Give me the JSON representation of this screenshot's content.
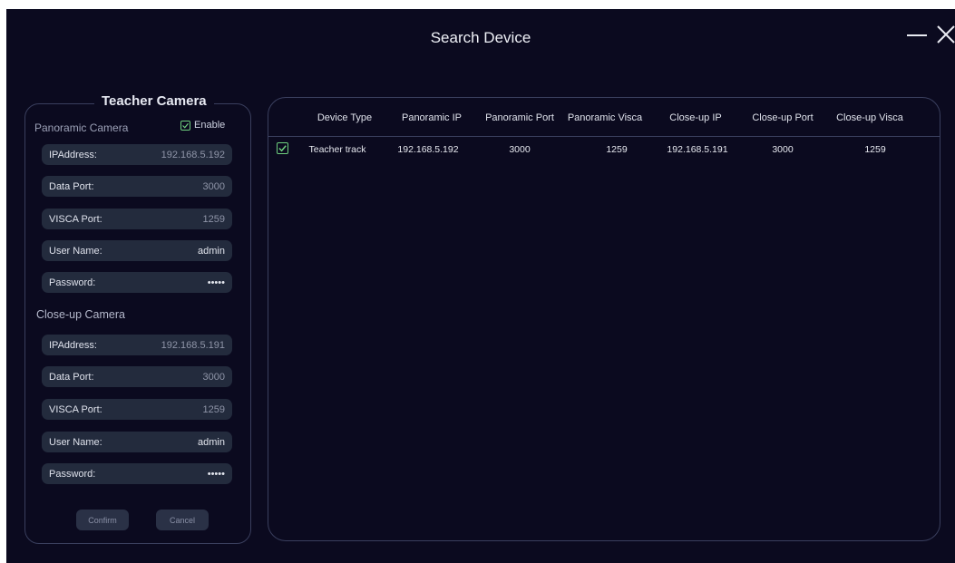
{
  "window": {
    "title": "Search Device",
    "minimize_icon": "minimize-icon",
    "close_icon": "close-icon"
  },
  "teacher_camera": {
    "group_title": "Teacher Camera",
    "panoramic": {
      "section_label": "Panoramic Camera",
      "enable_label": "Enable",
      "enable_checked": true,
      "fields": [
        {
          "label": "IPAddress:",
          "value": "192.168.5.192"
        },
        {
          "label": "Data Port:",
          "value": "3000"
        },
        {
          "label": "VISCA Port:",
          "value": "1259"
        },
        {
          "label": "User Name:",
          "value": "admin"
        },
        {
          "label": "Password:",
          "value": "•••••"
        }
      ]
    },
    "closeup": {
      "section_label": "Close-up Camera",
      "fields": [
        {
          "label": "IPAddress:",
          "value": "192.168.5.191"
        },
        {
          "label": "Data Port:",
          "value": "3000"
        },
        {
          "label": "VISCA Port:",
          "value": "1259"
        },
        {
          "label": "User Name:",
          "value": "admin"
        },
        {
          "label": "Password:",
          "value": "•••••"
        }
      ]
    },
    "confirm_label": "Confirm",
    "cancel_label": "Cancel"
  },
  "device_table": {
    "columns": [
      "Device Type",
      "Panoramic IP",
      "Panoramic Port",
      "Panoramic Visca",
      "Close-up IP",
      "Close-up Port",
      "Close-up Visca"
    ],
    "rows": [
      {
        "checked": true,
        "cells": [
          "Teacher track",
          "192.168.5.192",
          "3000",
          "1259",
          "192.168.5.191",
          "3000",
          "1259"
        ]
      }
    ]
  },
  "colors": {
    "background": "#0b0a1f",
    "field_bg": "#232b3d",
    "border": "#3a3f5e",
    "check_green": "#6ed07e"
  }
}
